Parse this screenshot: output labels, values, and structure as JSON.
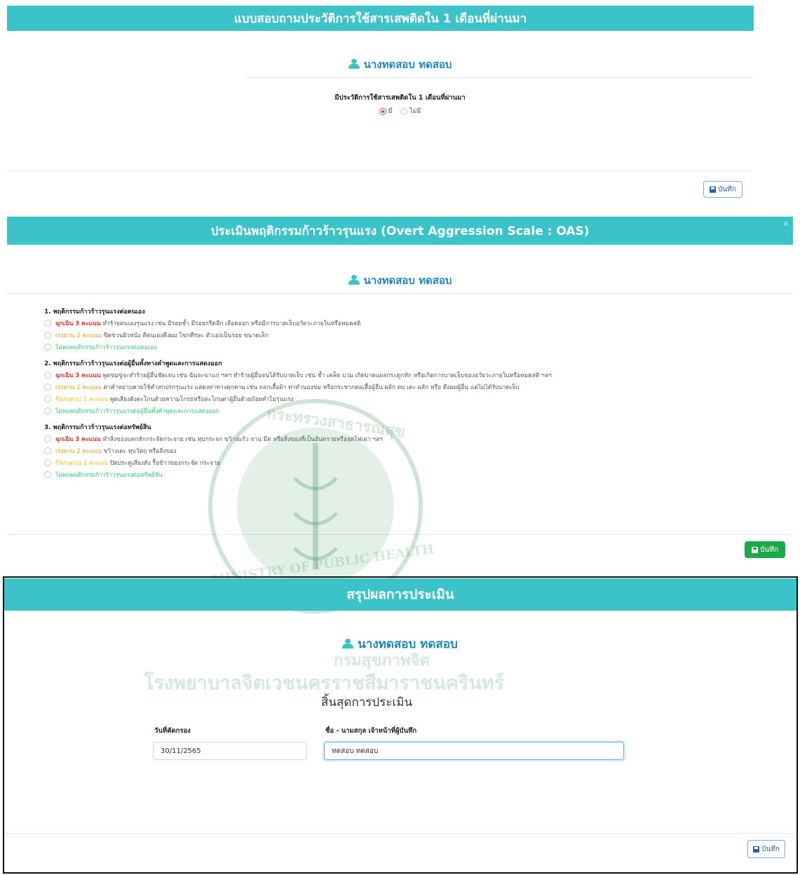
{
  "section1": {
    "title": "แบบสอบถามประวัติการใช้สารเสพติดใน 1 เดือนที่ผ่านมา",
    "user": "นางทดสอบ ทดสอบ",
    "question": "มีประวัติการใช้สารเสพติดใน 1 เดือนที่ผ่านมา",
    "options": [
      {
        "label": "มี",
        "checked": true
      },
      {
        "label": "ไม่มี",
        "checked": false
      }
    ],
    "save_label": "บันทึก"
  },
  "section2": {
    "title": "ประเมินพฤติกรรมก้าวร้าวรุนแรง (Overt Aggression Scale : OAS)",
    "close_label": "×",
    "user": "นางทดสอบ ทดสอบ",
    "groups": [
      {
        "title": "1. พฤติกรรมก้าวร้าวรุนแรงต่อตนเอง",
        "items": [
          {
            "level_label": "ฉุกเฉิน 3 คะแนน",
            "text": "ทำร้ายตนเองรุนแรง เช่น มีรอยช้ำ มีรอยกรีดลึก เลือดออก หรือมีการบาดเจ็บอวัยวะภายในหรือหมดสติ"
          },
          {
            "level_label": "เร่งด่วน 2 คะแนน",
            "text": "ขีดข่วนผิวหนัง ตีตนเองดึงผม โขกศีรษะ ตัวเองเป็นรอย ขนาดเล็ก"
          },
          {
            "level_label": "",
            "text": "ไม่พบพฤติกรรมก้าวร้าวรุนแรงต่อตนเอง"
          }
        ]
      },
      {
        "title": "2. พฤติกรรมก้าวร้าวรุนแรงต่อผู้อื่นทั้งทางคำพูดและการแสดงออก",
        "items": [
          {
            "level_label": "ฉุกเฉิน 3 คะแนน",
            "text": "พูดข่มขู่จะทำร้ายผู้อื่นชัดเจน เช่น ฉันจะฆ่าแก่ ฯลฯ ทำร้ายผู้อื่นจนได้รับบาดเจ็บ เช่น ช้ำ เคล็ด บวม เกิดบาดแผลกระดูกหัก หรือเกิดการบาดเจ็บของอวัยวะภายในหรือหมดสติ ฯลฯ"
          },
          {
            "level_label": "เร่งด่วน 2 คะแนน",
            "text": "ด่าคำหยาบคายใช้คำสกปรกรุนแรง แสดงท่าทางคุกคาม เช่น ถลกเสื้อผ้า ท่าทำนองข่ม หรือกระชากคอเสื้อผู้อื่น ผลัก ตบ เตะ ผลัก หรือ ดึงผมผู้อื่น แต่ไม่ได้รับบาดเจ็บ"
          },
          {
            "level_label": "กึ่งเร่งด่วน 1 คะแนน",
            "text": "พูดเสียงดังตะโกนด้วยความโกรธหรือตะโกนด่าผู้อื่นด้วยถ้อยคำไม่รุนแรง"
          },
          {
            "level_label": "",
            "text": "ไม่พบพฤติกรรมก้าวร้าวรุนแรงต่อผู้อื่นทั้งคำพูดและการแสดงออก"
          }
        ]
      },
      {
        "title": "3. พฤติกรรมก้าวร้าวรุนแรงต่อทรัพย์สิน",
        "items": [
          {
            "level_label": "ฉุกเฉิน 3 คะแนน",
            "text": "ทำสิ่งของแตกหักกระจัดกระจาย เช่น ทุบกระจก ขว้างแก้ว จาน มีด หรือสิ่งของที่เป็นอันตรายหรือจุดไฟเผา ฯลฯ"
          },
          {
            "level_label": "เร่งด่วน 2 คะแนน",
            "text": "ขว้างเตะ ทุบวัตถุ หรือสิ่งของ"
          },
          {
            "level_label": "กึ่งเร่งด่วน 1 คะแนน",
            "text": "ปิดประตูเสียงดัง รื้อข้าวของกระจัด กระจาย"
          },
          {
            "level_label": "",
            "text": "ไม่พบพฤติกรรมก้าวร้าวรุนแรงต่อทรัพย์สิน"
          }
        ]
      }
    ],
    "save_label": "บันทึก"
  },
  "section3": {
    "title": "สรุปผลการประเมิน",
    "user": "นางทดสอบ ทดสอบ",
    "end_text": "สิ้นสุดการประเมิน",
    "date_label": "วันที่คัดกรอง",
    "date_value": "30/11/2565",
    "recorder_label": "ชื่อ - นามสกุล เจ้าหน้าที่ผู้บันทึก",
    "recorder_value": "ทดสอบ ทดสอบ",
    "save_label": "บันทึก"
  },
  "watermark": {
    "seal_top": "กระทรวงสาธารณสุข",
    "seal_en": "MINISTRY OF PUBLIC HEALTH",
    "dept": "กรมสุขภาพจิต",
    "hospital": "โรงพยาบาลจิตเวชนครราชสีมาราชนครินทร์"
  },
  "colors": {
    "banner": "#3cc3c9",
    "user": "#1f86c6",
    "save_green": "#1ea84c",
    "urgent3": "#e3342f",
    "urgent2": "#f39c12",
    "urgent1": "#f1c40f",
    "none": "#2ecc71"
  }
}
